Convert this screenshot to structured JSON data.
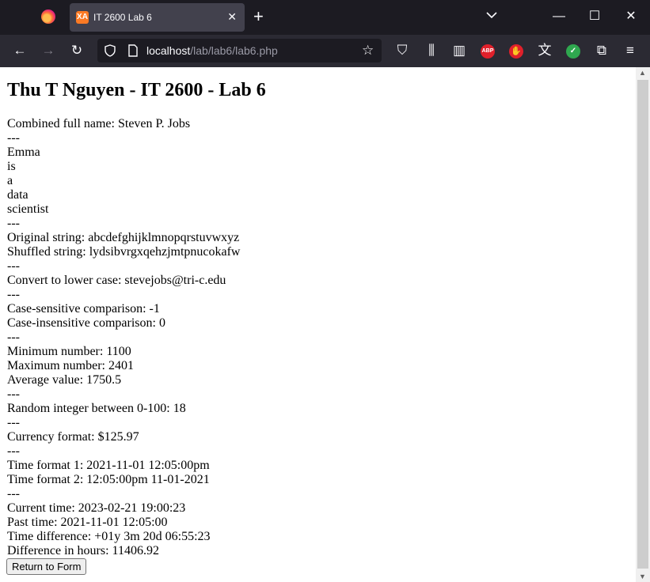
{
  "browser": {
    "tab_title": "IT 2600 Lab 6",
    "tab_favicon_text": "XA",
    "url_host": "localhost",
    "url_path": "/lab/lab6/lab6.php",
    "icons": [
      "firefox-logo",
      "xampp-favicon",
      "tab-close",
      "new-tab",
      "list-all-tabs",
      "minimize",
      "maximize",
      "close",
      "back",
      "forward",
      "reload",
      "tracking-shield",
      "page-info",
      "bookmark-star",
      "pocket",
      "library",
      "reader-sidebar",
      "adblock-plus",
      "ublock",
      "translate",
      "shield-extension",
      "extensions",
      "menu"
    ],
    "abp_label": "ABP"
  },
  "page": {
    "heading": "Thu T Nguyen - IT 2600 - Lab 6",
    "lines": [
      "Combined full name: Steven P. Jobs",
      "---",
      "Emma",
      "is",
      "a",
      "data",
      "scientist",
      "---",
      "Original string: abcdefghijklmnopqrstuvwxyz",
      "Shuffled string: lydsibvrgxqehzjmtpnucokafw",
      "---",
      "Convert to lower case: stevejobs@tri-c.edu",
      "---",
      "Case-sensitive comparison: -1",
      "Case-insensitive comparison: 0",
      "---",
      "Minimum number: 1100",
      "Maximum number: 2401",
      "Average value: 1750.5",
      "---",
      "Random integer between 0-100: 18",
      "---",
      "Currency format: $125.97",
      "---",
      "Time format 1: 2021-11-01 12:05:00pm",
      "Time format 2: 12:05:00pm 11-01-2021",
      "---",
      "Current time: 2023-02-21 19:00:23",
      "Past time: 2021-11-01 12:05:00",
      "Time difference: +01y 3m 20d 06:55:23",
      "Difference in hours: 11406.92"
    ],
    "button_label": "Return to Form"
  }
}
